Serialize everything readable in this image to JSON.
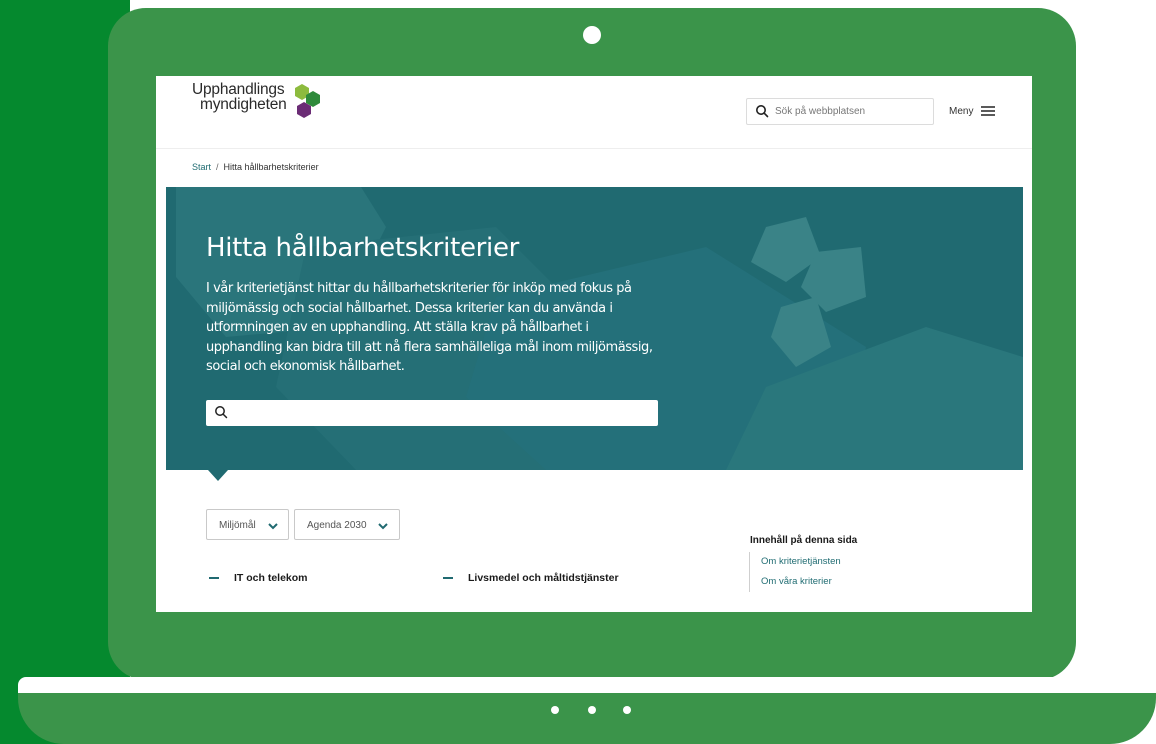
{
  "site": {
    "logo_line1": "Upphandlings",
    "logo_line2": "myndigheten",
    "colors": {
      "logo_light_green": "#8dbb3e",
      "logo_green": "#2f8a3b",
      "logo_purple": "#6b2c75",
      "teal": "#206a71",
      "frame_green": "#3b944a",
      "side_green": "#05892e"
    }
  },
  "header": {
    "search_placeholder": "Sök på webbplatsen",
    "search_icon": "search-icon",
    "menu_label": "Meny",
    "menu_icon": "hamburger-icon"
  },
  "breadcrumb": {
    "items": [
      "Start",
      "Hitta hållbarhetskriterier"
    ],
    "separator": "/"
  },
  "hero": {
    "title": "Hitta hållbarhetskriterier",
    "description": "I vår kriterietjänst hittar du hållbarhetskriterier för inköp med fokus på miljömässig och social hållbarhet. Dessa kriterier kan du använda i utformningen av en upphandling. Att ställa krav på hållbarhet i upphandling kan bidra till att nå flera samhälleliga mål inom miljömässig, social och ekonomisk hållbarhet.",
    "search_value": "",
    "search_icon": "search-icon"
  },
  "filters": [
    {
      "label": "Miljömål",
      "icon": "chevron-down-icon"
    },
    {
      "label": "Agenda 2030",
      "icon": "chevron-down-icon"
    }
  ],
  "toc": {
    "title": "Innehåll på denna sida",
    "items": [
      "Om kriterietjänsten",
      "Om våra kriterier"
    ]
  },
  "categories": [
    {
      "label": "IT och telekom",
      "icon": "minus-icon"
    },
    {
      "label": "Livsmedel och måltidstjänster",
      "icon": "minus-icon"
    }
  ]
}
